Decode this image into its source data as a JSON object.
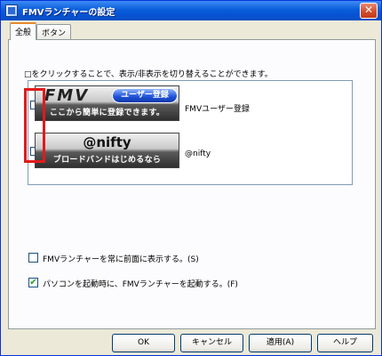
{
  "window": {
    "title": "FMVランチャーの設定",
    "close_glyph": "✕"
  },
  "tabs": [
    {
      "label": "全般",
      "active": true
    },
    {
      "label": "ボタン",
      "active": false
    }
  ],
  "general": {
    "instruction": "□をクリックすることで、表示/非表示を切り替えることができます。",
    "items": [
      {
        "checked": false,
        "banner_logo": "FMV",
        "banner_pill": "ユーザー登録",
        "banner_caption": "ここから簡単に登録できます。",
        "label": "FMVユーザー登録"
      },
      {
        "checked": false,
        "banner_logo": "@nifty",
        "banner_caption": "ブロードバンドはじめるなら",
        "label": "@nifty"
      }
    ],
    "options": [
      {
        "checked": false,
        "label": "FMVランチャーを常に前面に表示する。(S)"
      },
      {
        "checked": true,
        "label": "パソコンを起動時に、FMVランチャーを起動する。(F)"
      }
    ],
    "check_glyph": "✔"
  },
  "buttons": {
    "ok": "OK",
    "cancel": "キャンセル",
    "apply": "適用(A)",
    "help": "ヘルプ"
  },
  "colors": {
    "titlebar": "#0a5ed9",
    "highlight_box": "#e01b1b"
  }
}
